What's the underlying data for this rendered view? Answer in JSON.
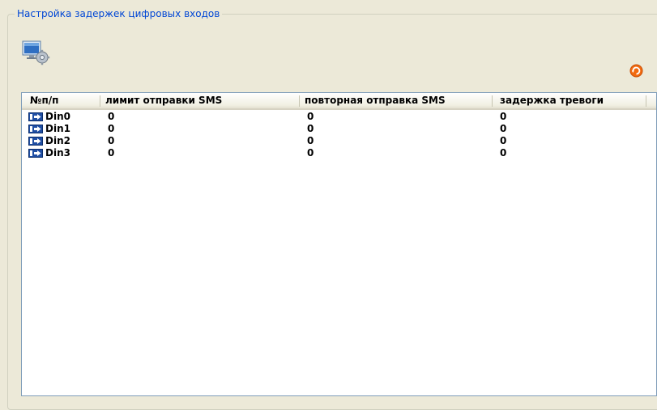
{
  "window": {
    "group_title": "Настройка задержек цифровых входов"
  },
  "toolbar": {
    "settings_icon": "settings-icon",
    "refresh_icon": "refresh-icon"
  },
  "table": {
    "columns": [
      "№п/п",
      "лимит отправки SMS",
      "повторная отправка SMS",
      "задержка тревоги"
    ],
    "rows": [
      {
        "name": "Din0",
        "sms_limit": "0",
        "sms_repeat": "0",
        "alarm_delay": "0"
      },
      {
        "name": "Din1",
        "sms_limit": "0",
        "sms_repeat": "0",
        "alarm_delay": "0"
      },
      {
        "name": "Din2",
        "sms_limit": "0",
        "sms_repeat": "0",
        "alarm_delay": "0"
      },
      {
        "name": "Din3",
        "sms_limit": "0",
        "sms_repeat": "0",
        "alarm_delay": "0"
      }
    ],
    "row_icon": "digital-input-icon"
  },
  "colors": {
    "background": "#ece9d8",
    "title": "#0046d5",
    "list_border": "#7f9db9",
    "icon_blue": "#1f4ea3",
    "refresh_orange": "#f26a0f"
  }
}
